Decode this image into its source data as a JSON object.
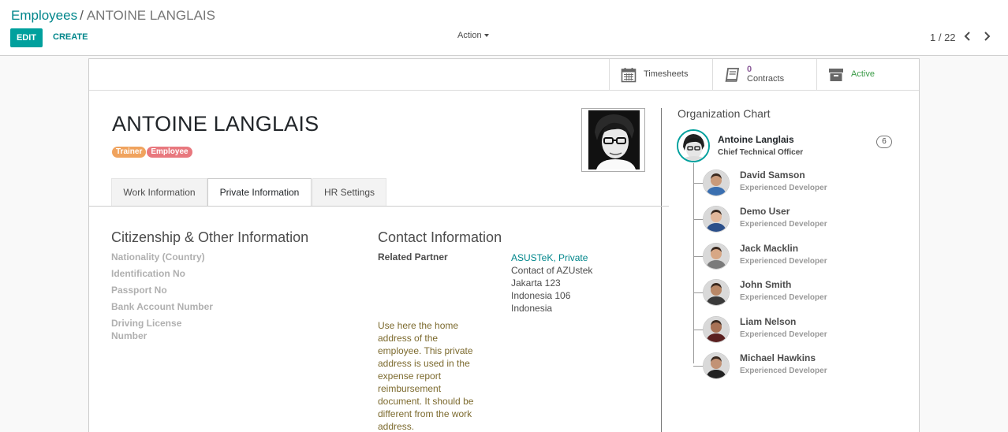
{
  "breadcrumb": {
    "parent": "Employees",
    "separator": "/",
    "current": "ANTOINE LANGLAIS"
  },
  "toolbar": {
    "edit_label": "EDIT",
    "create_label": "CREATE",
    "action_label": "Action"
  },
  "pager": {
    "value": "1 / 22"
  },
  "smart_buttons": {
    "timesheets": {
      "label": "Timesheets",
      "icon": "calendar-icon"
    },
    "contracts": {
      "count": "0",
      "label": "Contracts",
      "icon": "book-icon"
    },
    "active": {
      "label": "Active",
      "icon": "archive-icon"
    }
  },
  "employee": {
    "name": "ANTOINE LANGLAIS"
  },
  "tags": [
    {
      "label": "Trainer",
      "color": "#f0a35e"
    },
    {
      "label": "Employee",
      "color": "#e8787e"
    }
  ],
  "tabs": [
    {
      "label": "Work Information"
    },
    {
      "label": "Private Information"
    },
    {
      "label": "HR Settings"
    }
  ],
  "citizenship": {
    "title": "Citizenship & Other Information",
    "fields": [
      "Nationality (Country)",
      "Identification No",
      "Passport No",
      "Bank Account Number",
      "Driving License",
      "Number"
    ]
  },
  "contact": {
    "title": "Contact Information",
    "related_partner_label": "Related Partner",
    "partner_link": "ASUSTeK, Private",
    "address_lines": [
      "Contact of AZUstek",
      "Jakarta 123",
      "Indonesia 106",
      "Indonesia"
    ],
    "help_text": "Use here the home address of the employee. This private address is used in the expense report reimbursement document. It should be different from the work address."
  },
  "org_chart": {
    "title": "Organization Chart",
    "manager": {
      "name": "Antoine Langlais",
      "job": "Chief Technical Officer",
      "count": "6"
    },
    "subordinates": [
      {
        "name": "David Samson",
        "job": "Experienced Developer",
        "shirt": "#3a6fb0",
        "skin": "#c99a7a"
      },
      {
        "name": "Demo User",
        "job": "Experienced Developer",
        "shirt": "#2b4f8a",
        "skin": "#e2b79a"
      },
      {
        "name": "Jack Macklin",
        "job": "Experienced Developer",
        "shirt": "#7a7a7a",
        "skin": "#d7a785"
      },
      {
        "name": "John Smith",
        "job": "Experienced Developer",
        "shirt": "#3a3a3a",
        "skin": "#b98867"
      },
      {
        "name": "Liam Nelson",
        "job": "Experienced Developer",
        "shirt": "#5a2020",
        "skin": "#a87256"
      },
      {
        "name": "Michael Hawkins",
        "job": "Experienced Developer",
        "shirt": "#222222",
        "skin": "#c29275"
      }
    ]
  }
}
